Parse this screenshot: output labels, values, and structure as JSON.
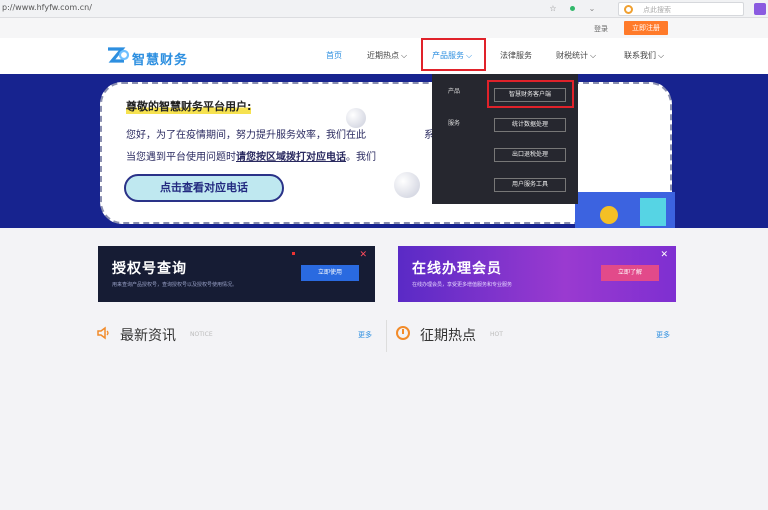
{
  "browser": {
    "url": "p://www.hfyfw.com.cn/",
    "search_placeholder": "点此搜索"
  },
  "topbar": {
    "login": "登录",
    "register": "立即注册"
  },
  "brand": {
    "name": "智慧财务",
    "accent_color": "#2d8fe0"
  },
  "nav": {
    "items": [
      {
        "label": "首页"
      },
      {
        "label": "近期热点"
      },
      {
        "label": "产品服务"
      },
      {
        "label": "法律服务"
      },
      {
        "label": "财税统计"
      },
      {
        "label": "联系我们"
      }
    ]
  },
  "banner": {
    "title": "尊敬的智慧财务平台用户:",
    "line1_a": "您好，为了在疫情期间，努力提升服务效率，我们在此",
    "line1_b": "系方式。",
    "line2_a": "当您遇到平台使用问题时",
    "line2_hl": "请您按区域拨打对应电话",
    "line2_b": "。我们",
    "cta": "点击查看对应电话"
  },
  "dropdown": {
    "left_items": [
      "产品",
      "服务"
    ],
    "items": [
      "智慧财务客户端",
      "统计数据处理",
      "出口退税处理",
      "用户服务工具"
    ]
  },
  "cards": [
    {
      "title": "授权号查询",
      "subtitle": "用来查询产品授权号，查询授权号以及授权号使用情况。",
      "button": "立即使用"
    },
    {
      "title": "在线办理会员",
      "subtitle": "在线办理会员，享受更多增值服务和专业服务",
      "button": "立即了解"
    }
  ],
  "news": {
    "title": "最新资讯",
    "en": "NOTICE",
    "more": "更多"
  },
  "hot": {
    "title": "征期热点",
    "en": "HOT",
    "more": "更多"
  },
  "colors": {
    "banner_bg": "#17238f",
    "highlight_box": "#e0222a",
    "register_orange": "#ff7a2a"
  }
}
